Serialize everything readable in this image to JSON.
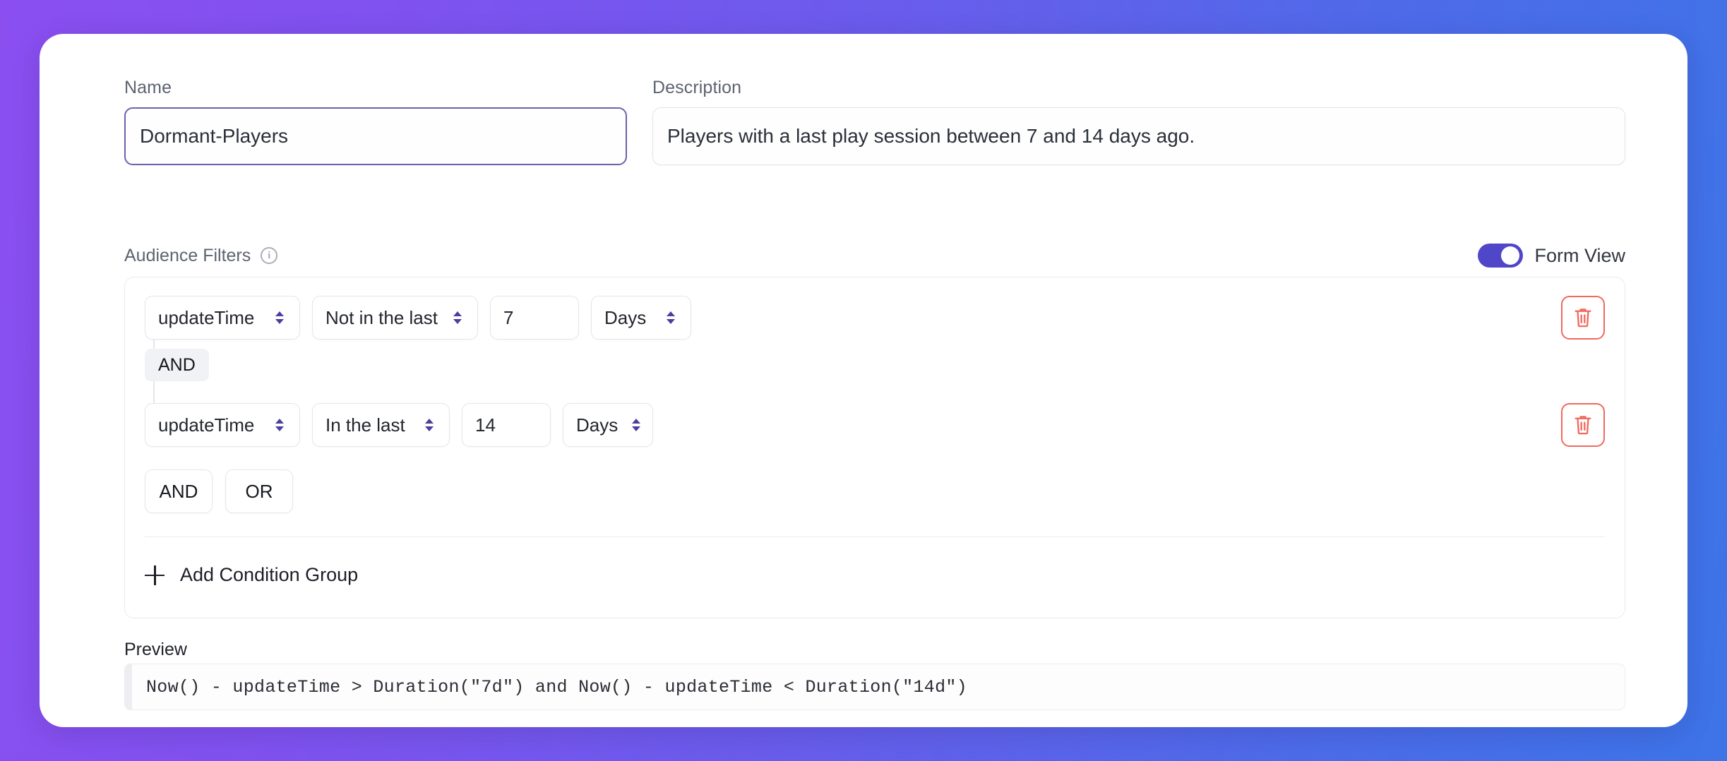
{
  "theme": {
    "gradient_start": "#8b4ff0",
    "gradient_end": "#3d74e8",
    "accent_purple": "#5046c8",
    "danger_red": "#f2685c"
  },
  "name_field": {
    "label": "Name",
    "value": "Dormant-Players",
    "placeholder": "Name"
  },
  "description_field": {
    "label": "Description",
    "value": "Players with a last play session between 7 and 14 days ago.",
    "placeholder": "Description"
  },
  "filters": {
    "title": "Audience Filters",
    "info_icon": "info-icon",
    "view_toggle": {
      "label": "Form View",
      "enabled": true
    },
    "conditions": [
      {
        "field": "updateTime",
        "operator": "Not in the last",
        "value": "7",
        "unit": "Days",
        "delete_icon": "trash-icon"
      },
      {
        "field": "updateTime",
        "operator": "In the last",
        "value": "14",
        "unit": "Days",
        "delete_icon": "trash-icon"
      }
    ],
    "joiner_badge": "AND",
    "logic_buttons": [
      "AND",
      "OR"
    ],
    "add_group": {
      "label": "Add Condition Group",
      "icon": "plus-icon"
    }
  },
  "preview": {
    "label": "Preview",
    "code": "Now() - updateTime > Duration(\"7d\") and Now() - updateTime < Duration(\"14d\")"
  }
}
